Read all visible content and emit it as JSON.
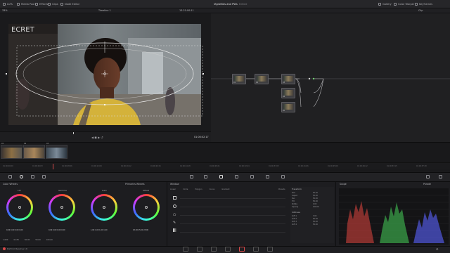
{
  "topbar": {
    "left_items": [
      "LUTs",
      "Media Pool",
      "Effects",
      "Clips",
      "Node Editor"
    ],
    "project_title": "Vignettes and PWs",
    "edited_label": "Edited",
    "right_items": [
      "Gallery",
      "Color Warper",
      "Keyframes",
      "Clip"
    ]
  },
  "viewer": {
    "zoom": "33%",
    "timeline_name": "Timeline 1",
    "timecode_top": "13:21:00:11",
    "timecode_bottom": "01:00:02:17"
  },
  "nodes": {
    "labels": [
      "01",
      "02",
      "03",
      "04",
      "05"
    ]
  },
  "clips": {
    "items": [
      {
        "label": "01",
        "sub": "Apple ProRes"
      },
      {
        "label": "02",
        "sub": "00:00:05:11"
      },
      {
        "label": "03",
        "sub": "00:00:07:22"
      }
    ]
  },
  "ruler": {
    "ticks": [
      "01:00:00:00",
      "01:00:04:03",
      "01:00:08:06",
      "01:00:12:09",
      "01:00:16:12",
      "01:00:20:15",
      "01:00:24:18",
      "01:00:28:21",
      "01:00:32:24",
      "01:00:37:03",
      "01:00:41:06",
      "01:00:45:09",
      "01:00:49:12",
      "01:00:53:15",
      "01:00:57:18"
    ]
  },
  "color_wheels": {
    "title": "Color Wheels",
    "mode": "Primaries Wheels",
    "wheels": [
      {
        "name": "Lift",
        "values": "0.00  0.00  0.00  0.00"
      },
      {
        "name": "Gamma",
        "values": "0.00  0.00  0.00  0.00"
      },
      {
        "name": "Gain",
        "values": "1.00  1.00  1.00  1.00"
      },
      {
        "name": "Offset",
        "values": "25.00  25.00  25.00"
      }
    ],
    "bottom": {
      "contrast": "1.000",
      "pivot": "0.435",
      "sat": "50.00",
      "hue": "50.00",
      "lum_mix": "100.00"
    }
  },
  "window": {
    "title": "Window",
    "tabs": [
      "Linear",
      "Circle",
      "Polygon",
      "Curve",
      "Gradient"
    ],
    "transform_title": "Transform",
    "transform_rows": [
      {
        "k": "Size",
        "v": "50.00"
      },
      {
        "k": "Aspect",
        "v": "50.00"
      },
      {
        "k": "Pan",
        "v": "50.00"
      },
      {
        "k": "Tilt",
        "v": "50.00"
      },
      {
        "k": "Rotate",
        "v": "0.00"
      },
      {
        "k": "Opacity",
        "v": "100.00"
      }
    ],
    "softness_title": "Softness",
    "softness_rows": [
      {
        "k": "Soft 1",
        "v": "3.00"
      },
      {
        "k": "Soft 2",
        "v": "50.00"
      },
      {
        "k": "Soft 3",
        "v": "50.00"
      },
      {
        "k": "Soft 4",
        "v": "50.00"
      }
    ],
    "presets_label": "Presets"
  },
  "scope": {
    "title": "Scope",
    "mode": "Parade",
    "y_ticks": [
      "1023",
      "896",
      "768",
      "640",
      "512",
      "384",
      "256",
      "128",
      "0"
    ]
  },
  "footer": {
    "app_name": "DaVinci Resolve 19"
  },
  "colors": {
    "accent": "#d84a4a",
    "wheel_lift": "#ff3b3b",
    "parade_red": "#e0453f",
    "parade_green": "#46d05a",
    "parade_blue": "#5a63ff"
  }
}
